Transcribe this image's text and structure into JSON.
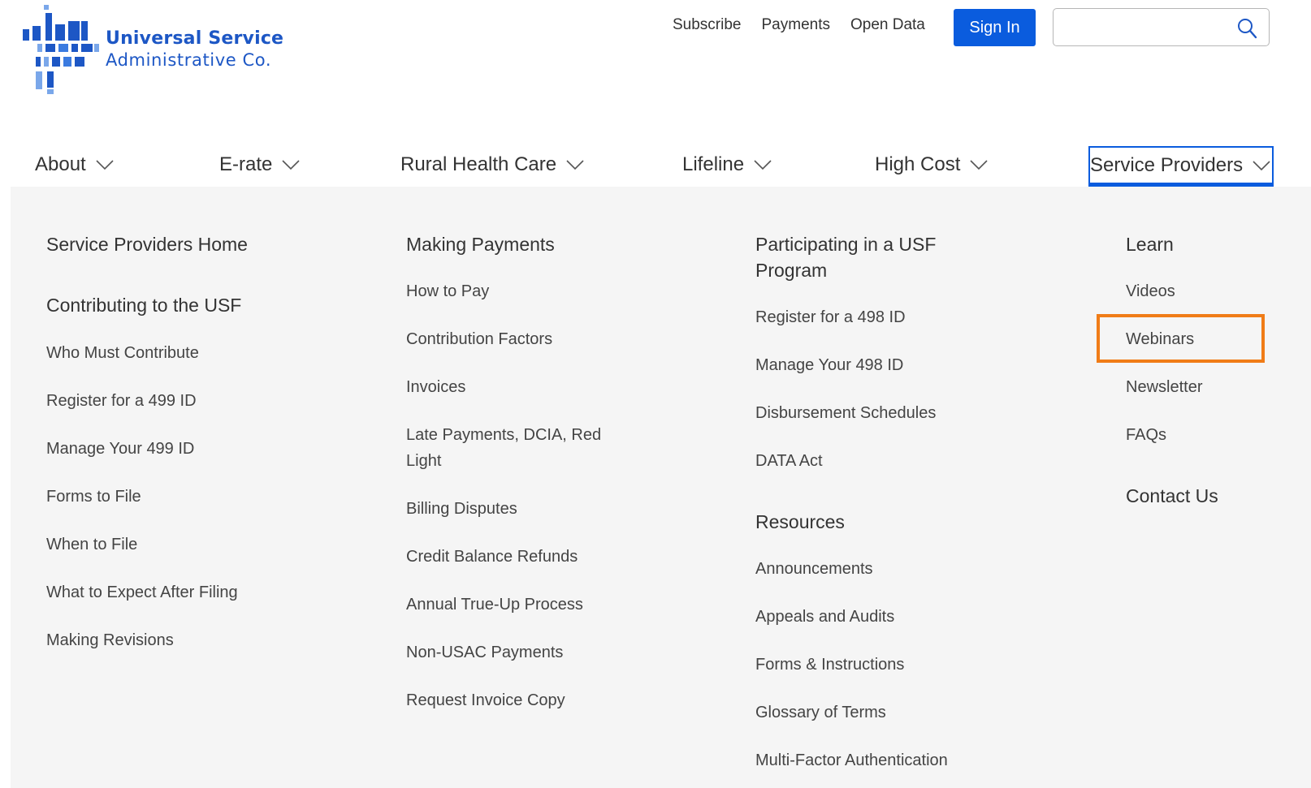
{
  "logo": {
    "line1": "Universal Service",
    "line2": "Administrative Co."
  },
  "utility_nav": {
    "links": [
      "Subscribe",
      "Payments",
      "Open Data"
    ],
    "signin_label": "Sign In",
    "search_placeholder": ""
  },
  "main_nav": {
    "items": [
      {
        "label": "About"
      },
      {
        "label": "E-rate"
      },
      {
        "label": "Rural Health Care"
      },
      {
        "label": "Lifeline"
      },
      {
        "label": "High Cost"
      },
      {
        "label": "Service Providers",
        "active": true
      }
    ]
  },
  "dropdown": {
    "col1": {
      "heading1": "Service Providers Home",
      "heading2": "Contributing to the USF",
      "links": [
        "Who Must Contribute",
        "Register for a 499 ID",
        "Manage Your 499 ID",
        "Forms to File",
        "When to File",
        "What to Expect After Filing",
        "Making Revisions"
      ]
    },
    "col2": {
      "heading": "Making Payments",
      "links": [
        "How to Pay",
        "Contribution Factors",
        "Invoices",
        "Late Payments, DCIA, Red",
        "Light",
        "Billing Disputes",
        "Credit Balance Refunds",
        "Annual True-Up Process",
        "Non-USAC Payments",
        "Request Invoice Copy"
      ]
    },
    "col3": {
      "heading_line1": "Participating in a USF",
      "heading_line2": "Program",
      "links": [
        "Register for a 498 ID",
        "Manage Your 498 ID",
        "Disbursement Schedules",
        "DATA Act"
      ],
      "heading2": "Resources",
      "links2": [
        "Announcements",
        "Appeals and Audits",
        "Forms & Instructions",
        "Glossary of Terms",
        "Multi-Factor Authentication"
      ]
    },
    "col4": {
      "heading": "Learn",
      "links": [
        "Videos",
        "Webinars",
        "Newsletter",
        "FAQs"
      ],
      "heading2": "Contact Us"
    }
  },
  "colors": {
    "brand_blue": "#0a5cde",
    "logo_blue": "#1d57c5",
    "highlight_orange": "#f07c17",
    "panel_bg": "#f5f5f5"
  }
}
